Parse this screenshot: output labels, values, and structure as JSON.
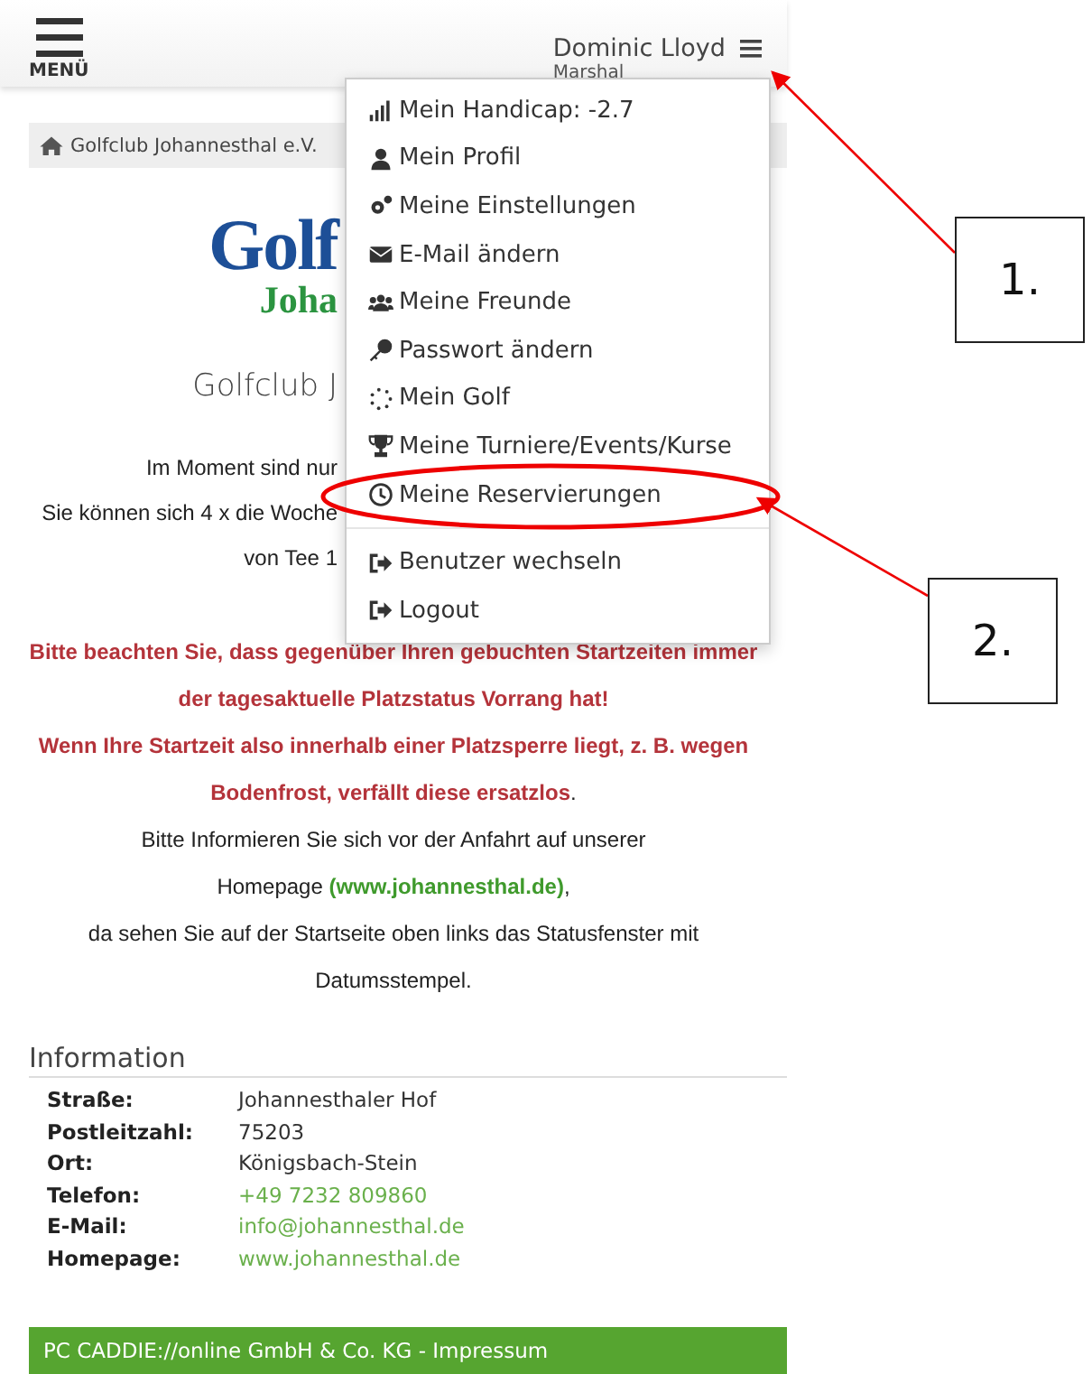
{
  "header": {
    "menu_label": "MENÜ",
    "user_name": "Dominic Lloyd",
    "user_role": "Marshal"
  },
  "breadcrumb": "Golfclub Johannesthal e.V.",
  "logo": {
    "line_1": "Golf",
    "line_2": "Joha"
  },
  "club_title": "Golfclub J",
  "intro_lines": [
    "Im Moment sind nur",
    "Sie können sich 4 x die Woche",
    "von Tee 1"
  ],
  "warnings": [
    "**Bitte beachten Sie, dass gegenüber Ihren gebuchten Startzeiten immer der tagesaktuelle Platzstatus Vorrang hat!**",
    "**Wenn Ihre Startzeit also innerhalb einer Platzsperre liegt, z. B. wegen Bodenfrost, verfällt diese ersatzlos**."
  ],
  "info_lines": [
    {
      "text": "Bitte Informieren Sie sich vor der Anfahrt auf unserer"
    },
    {
      "text": "Homepage ",
      "link": "(www.johannesthal.de)",
      "after": ","
    },
    {
      "text": "da sehen Sie auf der Startseite oben links das Statusfenster mit"
    },
    {
      "text": "Datumsstempel."
    }
  ],
  "information": {
    "title": "Information",
    "rows": [
      {
        "label": "Straße:",
        "value": "Johannesthaler Hof",
        "kind": "text"
      },
      {
        "label": "Postleitzahl:",
        "value": "75203",
        "kind": "text"
      },
      {
        "label": "Ort:",
        "value": "Königsbach-Stein",
        "kind": "text"
      },
      {
        "label": "Telefon:",
        "value": "+49 7232 809860",
        "kind": "link"
      },
      {
        "label": "E-Mail:",
        "value": "info@johannesthal.de",
        "kind": "link"
      },
      {
        "label": "Homepage:",
        "value": "www.johannesthal.de",
        "kind": "link"
      }
    ]
  },
  "footer": "PC CADDIE://online GmbH & Co. KG - Impressum",
  "user_menu": {
    "groups": [
      [
        {
          "label": "Mein Handicap: -2.7",
          "kind": "handicap"
        },
        {
          "label": "Mein Profil",
          "kind": "profile"
        },
        {
          "label": "Meine Einstellungen",
          "kind": "settings"
        },
        {
          "label": "E-Mail ändern",
          "kind": "mail"
        },
        {
          "label": "Meine Freunde",
          "kind": "friends"
        },
        {
          "label": "Passwort ändern",
          "kind": "key"
        },
        {
          "label": "Mein Golf",
          "kind": "golf"
        },
        {
          "label": "Meine Turniere/Events/Kurse",
          "kind": "trophy"
        },
        {
          "label": "Meine Reservierungen",
          "kind": "clock"
        }
      ],
      [
        {
          "label": "Benutzer wechseln",
          "kind": "signout"
        },
        {
          "label": "Logout",
          "kind": "signout"
        }
      ]
    ]
  },
  "annotations": [
    {
      "label": "1."
    },
    {
      "label": "2."
    }
  ]
}
